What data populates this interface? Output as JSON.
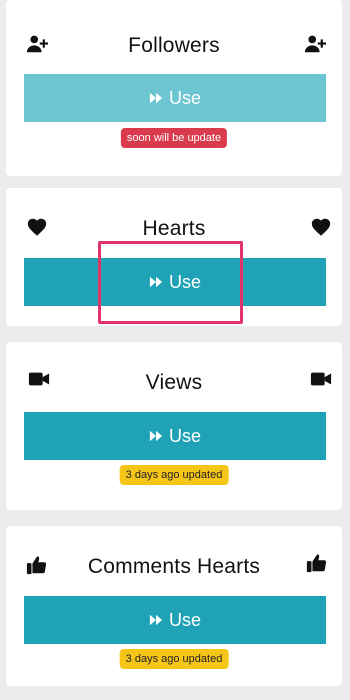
{
  "colors": {
    "background": "#ececec",
    "card": "#ffffff",
    "button_primary": "#1fa2b5",
    "button_disabled": "#6dc5d2",
    "badge_red": "#d93a4c",
    "badge_yellow": "#f5c518",
    "highlight": "#e0356a"
  },
  "cards": [
    {
      "title": "Followers",
      "icon": "user-plus-icon",
      "button_label": "Use",
      "button_state": "disabled",
      "badge": "soon will be update",
      "badge_style": "red"
    },
    {
      "title": "Hearts",
      "icon": "heart-icon",
      "button_label": "Use",
      "button_state": "active",
      "badge": "",
      "badge_style": ""
    },
    {
      "title": "Views",
      "icon": "video-camera-icon",
      "button_label": "Use",
      "button_state": "active",
      "badge": "3 days ago updated",
      "badge_style": "yellow"
    },
    {
      "title": "Comments Hearts",
      "icon": "thumbs-up-icon",
      "button_label": "Use",
      "button_state": "active",
      "badge": "3 days ago updated",
      "badge_style": "yellow"
    }
  ]
}
